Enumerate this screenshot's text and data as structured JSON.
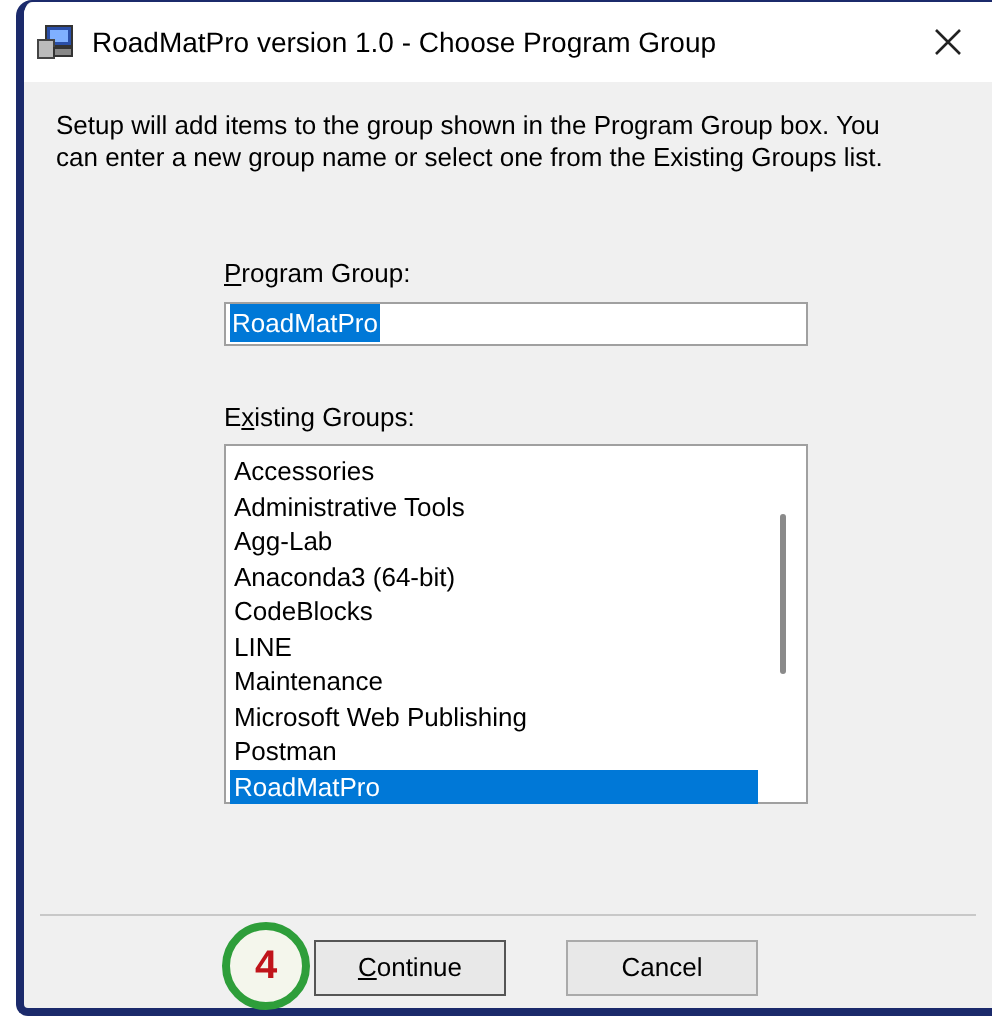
{
  "window": {
    "title": "RoadMatPro version 1.0 - Choose Program Group"
  },
  "description": "Setup will add items to the group shown in the Program Group box. You can enter a new group name or select one from the Existing Groups list.",
  "program_group": {
    "label": {
      "key": "P",
      "after": "rogram Group:"
    },
    "value": "RoadMatPro",
    "selected": true
  },
  "existing_groups": {
    "label": {
      "before": "E",
      "key": "x",
      "after": "isting Groups:"
    },
    "items": [
      {
        "name": "Accessories",
        "selected": false
      },
      {
        "name": "Administrative Tools",
        "selected": false
      },
      {
        "name": "Agg-Lab",
        "selected": false
      },
      {
        "name": "Anaconda3 (64-bit)",
        "selected": false
      },
      {
        "name": "CodeBlocks",
        "selected": false
      },
      {
        "name": "LINE",
        "selected": false
      },
      {
        "name": "Maintenance",
        "selected": false
      },
      {
        "name": "Microsoft Web Publishing",
        "selected": false
      },
      {
        "name": "Postman",
        "selected": false
      },
      {
        "name": "RoadMatPro",
        "selected": true
      }
    ]
  },
  "step_badge": "4",
  "buttons": [
    {
      "label": {
        "key": "C",
        "after": "ontinue"
      },
      "default": true
    },
    {
      "label": {
        "before": "Cancel"
      },
      "default": false
    }
  ]
}
